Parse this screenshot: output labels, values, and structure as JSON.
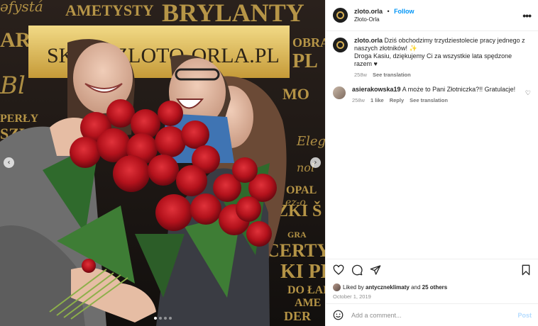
{
  "post": {
    "username": "zloto.orla",
    "follow_label": "Follow",
    "separator": "•",
    "location": "Złoto-Orla",
    "more_label": "•••"
  },
  "caption": {
    "username": "zloto.orla",
    "text": "Dziś obchodzimy trzydziestolecie pracy jednego z naszych złotników! ✨\nDroga Kasiu, dziękujemy Ci za wszystkie lata spędzone razem ♥",
    "age": "258w",
    "see_translation": "See translation"
  },
  "comments": [
    {
      "username": "asierakowska19",
      "text": "A może to Pani Złotniczka?!! Gratulacje!",
      "age": "258w",
      "likes": "1 like",
      "reply": "Reply",
      "see_translation": "See translation"
    }
  ],
  "likes": {
    "prefix": "Liked by",
    "user": "antyczneklimaty",
    "and": "and",
    "others": "25 others"
  },
  "date": "October 1, 2019",
  "add_comment": {
    "placeholder": "Add a comment...",
    "post_label": "Post"
  },
  "media": {
    "banner_text": "SKLEP.ZLOTO-ORLA.PL",
    "backdrop_words": [
      "AMETYSTY",
      "BRYLANTY",
      "PLATYNA",
      "CERTYFIKATY",
      "PERŁY",
      "SZKI",
      "OPAL",
      "GRAWER",
      "ELEGANCJA",
      "AMETYSTY",
      "OBRĄCZKI",
      "DO ŁAŃCUCHA",
      "DER",
      "A DO"
    ],
    "carousel_prev": "‹",
    "carousel_next": "›",
    "slide_count": 4,
    "active_slide": 1
  },
  "colors": {
    "accent": "#0095f6",
    "gold": "#d4ad52",
    "rose": "#b4121c"
  }
}
